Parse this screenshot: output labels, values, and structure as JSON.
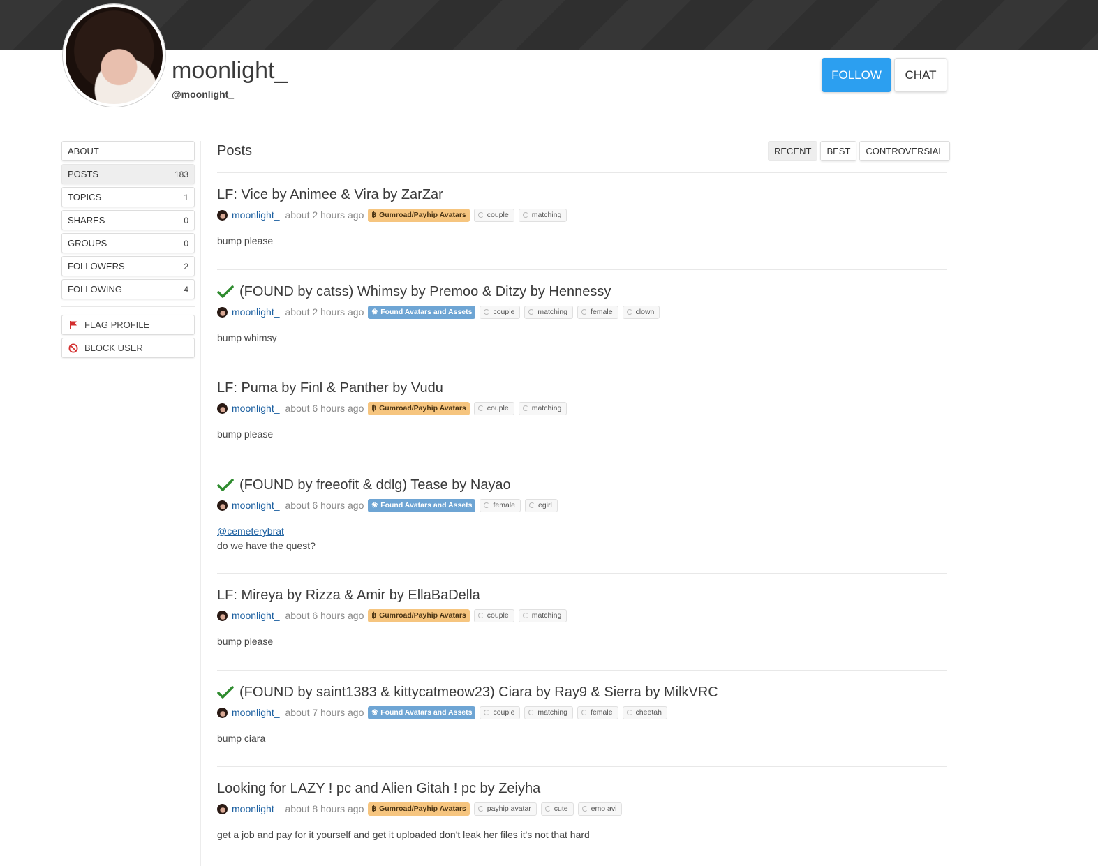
{
  "profile": {
    "display_name": "moonlight_",
    "handle": "@moonlight_",
    "follow_label": "FOLLOW",
    "chat_label": "CHAT"
  },
  "sidebar": {
    "items": [
      {
        "label": "ABOUT",
        "count": ""
      },
      {
        "label": "POSTS",
        "count": "183"
      },
      {
        "label": "TOPICS",
        "count": "1"
      },
      {
        "label": "SHARES",
        "count": "0"
      },
      {
        "label": "GROUPS",
        "count": "0"
      },
      {
        "label": "FOLLOWERS",
        "count": "2"
      },
      {
        "label": "FOLLOWING",
        "count": "4"
      }
    ],
    "actions": [
      {
        "label": "FLAG PROFILE",
        "icon": "flag-icon"
      },
      {
        "label": "BLOCK USER",
        "icon": "block-icon"
      }
    ]
  },
  "posts_section": {
    "heading": "Posts",
    "sort_tabs": [
      "RECENT",
      "BEST",
      "CONTROVERSIAL"
    ]
  },
  "colors": {
    "follow_blue": "#2c9ff0",
    "gumroad_category": "#f6c57f",
    "found_category": "#6ea5d4",
    "author_link": "#1b5fa0",
    "check_green": "#2e8b2e"
  },
  "posts": [
    {
      "title": "LF: Vice by Animee & Vira by ZarZar",
      "found": false,
      "author": "moonlight_",
      "time": "about 2 hours ago",
      "category": "Gumroad/Payhip Avatars",
      "tags": [
        "couple",
        "matching"
      ],
      "mention": "",
      "body": "bump please"
    },
    {
      "title": "(FOUND by catss) Whimsy by Premoo & Ditzy by Hennessy",
      "found": true,
      "author": "moonlight_",
      "time": "about 2 hours ago",
      "category": "Found Avatars and Assets",
      "tags": [
        "couple",
        "matching",
        "female",
        "clown"
      ],
      "mention": "",
      "body": "bump whimsy"
    },
    {
      "title": "LF: Puma by Finl & Panther by Vudu",
      "found": false,
      "author": "moonlight_",
      "time": "about 6 hours ago",
      "category": "Gumroad/Payhip Avatars",
      "tags": [
        "couple",
        "matching"
      ],
      "mention": "",
      "body": "bump please"
    },
    {
      "title": "(FOUND by freeofit & ddlg) Tease by Nayao",
      "found": true,
      "author": "moonlight_",
      "time": "about 6 hours ago",
      "category": "Found Avatars and Assets",
      "tags": [
        "female",
        "egirl"
      ],
      "mention": "@cemeterybrat",
      "body": "do we have the quest?"
    },
    {
      "title": "LF: Mireya by Rizza & Amir by EllaBaDella",
      "found": false,
      "author": "moonlight_",
      "time": "about 6 hours ago",
      "category": "Gumroad/Payhip Avatars",
      "tags": [
        "couple",
        "matching"
      ],
      "mention": "",
      "body": "bump please"
    },
    {
      "title": "(FOUND by saint1383 & kittycatmeow23) Ciara by Ray9 & Sierra by MilkVRC",
      "found": true,
      "author": "moonlight_",
      "time": "about 7 hours ago",
      "category": "Found Avatars and Assets",
      "tags": [
        "couple",
        "matching",
        "female",
        "cheetah"
      ],
      "mention": "",
      "body": "bump ciara"
    },
    {
      "title": "Looking for LAZY ! pc and Alien Gitah ! pc by Zeiyha",
      "found": false,
      "author": "moonlight_",
      "time": "about 8 hours ago",
      "category": "Gumroad/Payhip Avatars",
      "tags": [
        "payhip avatar",
        "cute",
        "emo avi"
      ],
      "mention": "",
      "body": "get a job and pay for it yourself and get it uploaded don't leak her files it's not that hard"
    }
  ]
}
